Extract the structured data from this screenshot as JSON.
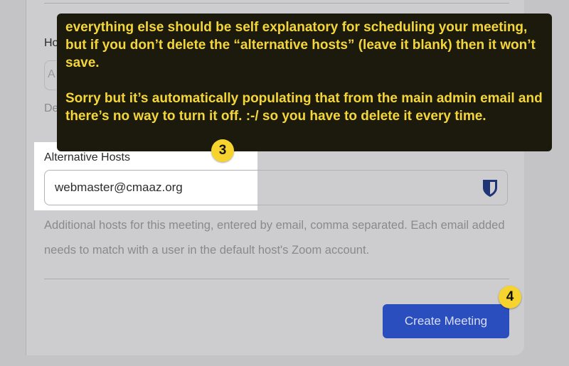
{
  "form": {
    "partial_label": "Ho",
    "partial_input_value": "A",
    "partial_help": "De",
    "alt_hosts_label": "Alternative Hosts",
    "alt_hosts_value": "webmaster@cmaaz.org",
    "alt_hosts_help": "Additional hosts for this meeting, entered by email, comma separated. Each email added needs to match with a user in the default host's Zoom account.",
    "submit_label": "Create Meeting",
    "button_color": "#2b4ebf"
  },
  "annotation": {
    "tooltip_paragraph_1": "everything else should be self explanatory for scheduling your meeting, but if you don’t delete the “alternative hosts” (leave it blank) then it won’t save.",
    "tooltip_paragraph_2": "Sorry but it’s automatically populating that from the main admin email and there’s no way to turn it off. :-/  so you have to delete it every time.",
    "step_3": "3",
    "step_4": "4",
    "tooltip_bg": "#1b1a0d",
    "tooltip_text_color": "#f4d63a",
    "badge_color": "#f6d32d"
  },
  "icons": {
    "password_manager": "bitwarden-shield-icon"
  }
}
